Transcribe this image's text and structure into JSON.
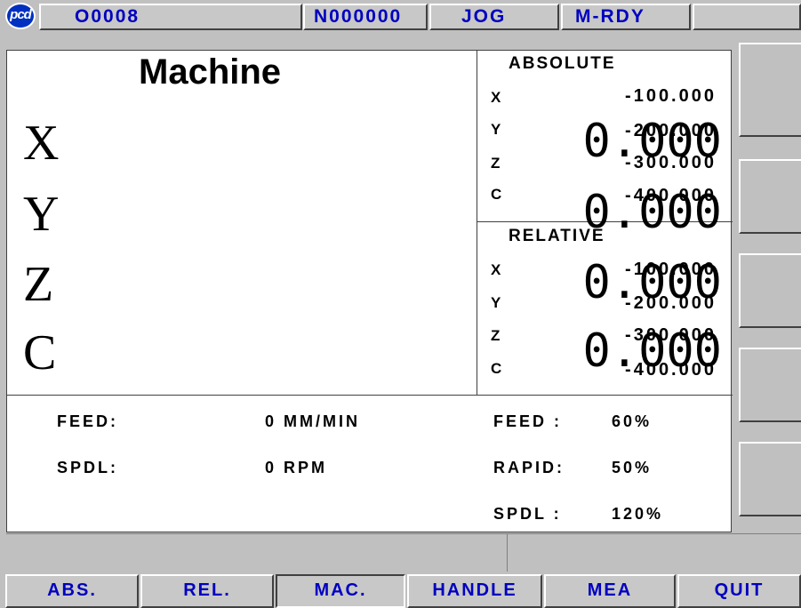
{
  "status_bar": {
    "logo": "pcd",
    "program": "O0008",
    "sequence": "N000000",
    "mode": "JOG",
    "state": "M-RDY",
    "extra": ""
  },
  "machine": {
    "title": "Machine",
    "axes": [
      {
        "axis": "X",
        "value": "0.000"
      },
      {
        "axis": "Y",
        "value": "0.000"
      },
      {
        "axis": "Z",
        "value": "0.000"
      },
      {
        "axis": "C",
        "value": "0.000"
      }
    ]
  },
  "absolute": {
    "title": "ABSOLUTE",
    "axes": [
      {
        "axis": "X",
        "value": "-100.000"
      },
      {
        "axis": "Y",
        "value": "-200.000"
      },
      {
        "axis": "Z",
        "value": "-300.000"
      },
      {
        "axis": "C",
        "value": "-400.000"
      }
    ]
  },
  "relative": {
    "title": "RELATIVE",
    "axes": [
      {
        "axis": "X",
        "value": "-100.000"
      },
      {
        "axis": "Y",
        "value": "-200.000"
      },
      {
        "axis": "Z",
        "value": "-300.000"
      },
      {
        "axis": "C",
        "value": "-400.000"
      }
    ]
  },
  "info": {
    "feed_label": "FEED:",
    "feed_value": "0 MM/MIN",
    "spdl_label": "SPDL:",
    "spdl_value": "0 RPM",
    "feed_ovr_label": "FEED :",
    "feed_ovr_value": "60%",
    "rapid_ovr_label": "RAPID:",
    "rapid_ovr_value": "50%",
    "spdl_ovr_label": "SPDL :",
    "spdl_ovr_value": "120%"
  },
  "function_keys": [
    "ABS.",
    "REL.",
    "MAC.",
    "HANDLE",
    "MEA",
    "QUIT"
  ],
  "colors": {
    "accent": "#0000c0",
    "panel": "#ffffff",
    "chrome": "#c0c0c0"
  }
}
